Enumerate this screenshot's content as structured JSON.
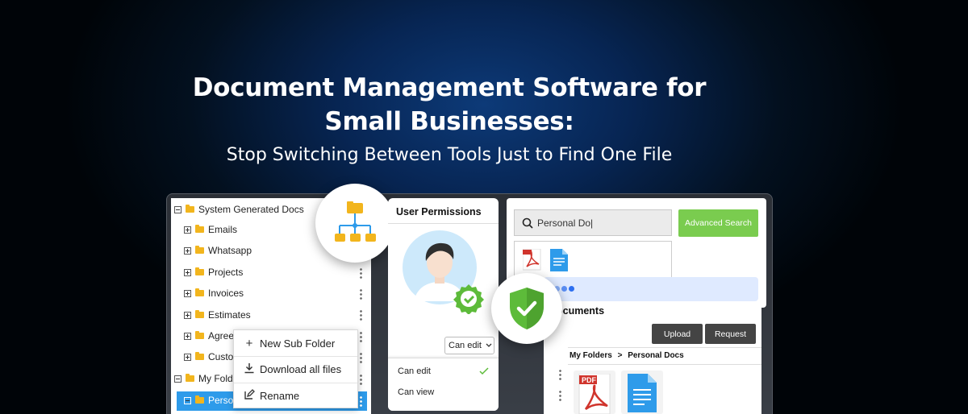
{
  "hero": {
    "title_line1": "Document Management Software for",
    "title_line2": "Small Businesses:",
    "subtitle": "Stop Switching Between Tools Just to Find One File"
  },
  "tree": {
    "root": "System Generated Docs",
    "items": [
      "Emails",
      "Whatsapp",
      "Projects",
      "Invoices",
      "Estimates",
      "Agree",
      "Custo"
    ],
    "my_folders": "My Folde",
    "selected": "Perso"
  },
  "context_menu": {
    "new_sub_folder": "New Sub Folder",
    "download_all": "Download all files",
    "rename": "Rename"
  },
  "permissions": {
    "title": "User Permissions",
    "selected": "Can edit",
    "options": [
      "Can edit",
      "Can view"
    ]
  },
  "search": {
    "query": "Personal Do|",
    "advanced_label": "Advanced Search"
  },
  "documents": {
    "title": "ocuments",
    "upload_label": "Upload",
    "request_label": "Request",
    "breadcrumb_root": "My Folders",
    "breadcrumb_sep": ">",
    "breadcrumb_current": "Personal Docs",
    "pdf_label": "PDF"
  },
  "colors": {
    "accent_blue": "#2e9bea",
    "advanced_green": "#7acc4f",
    "shield_green": "#5dbb3a",
    "folder_yellow": "#f2b51d"
  },
  "icons": [
    "folder-icon",
    "org-chart-icon",
    "avatar-icon",
    "verified-badge-icon",
    "shield-check-icon",
    "search-icon",
    "pdf-icon",
    "document-icon",
    "plus-icon",
    "download-icon",
    "rename-icon",
    "chevron-down-icon",
    "check-icon",
    "kebab-icon"
  ]
}
